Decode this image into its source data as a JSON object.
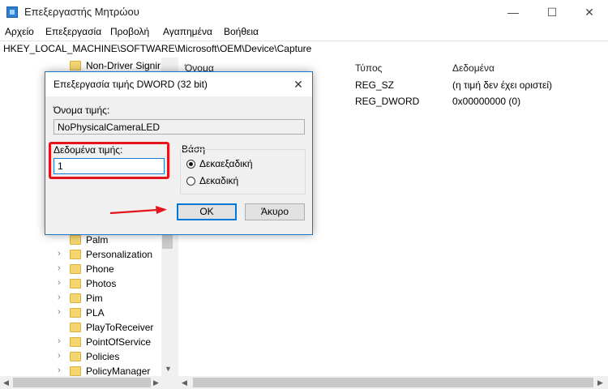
{
  "window": {
    "title": "Επεξεργαστής Μητρώου",
    "minimize_glyph": "—",
    "maximize_glyph": "☐",
    "close_glyph": "✕"
  },
  "menu": [
    "Αρχείο",
    "Επεξεργασία",
    "Προβολή",
    "Αγαπημένα",
    "Βοήθεια"
  ],
  "address": "HKEY_LOCAL_MACHINE\\SOFTWARE\\Microsoft\\OEM\\Device\\Capture",
  "tree": {
    "top_item": "Non-Driver Signir",
    "items": [
      "Palm",
      "Personalization",
      "Phone",
      "Photos",
      "Pim",
      "PLA",
      "PlayToReceiver",
      "PointOfService",
      "Policies",
      "PolicyManager"
    ]
  },
  "list": {
    "columns": [
      "Όνομα",
      "Τύπος",
      "Δεδομένα"
    ],
    "rows": [
      {
        "type": "REG_SZ",
        "data": "(η τιμή δεν έχει οριστεί)"
      },
      {
        "type": "REG_DWORD",
        "data": "0x00000000 (0)"
      }
    ]
  },
  "dialog": {
    "title": "Επεξεργασία τιμής DWORD (32 bit)",
    "close_glyph": "✕",
    "name_label": "Όνομα τιμής:",
    "name_value": "NoPhysicalCameraLED",
    "data_label": "Δεδομένα τιμής:",
    "data_value": "1",
    "base_label": "Βάση",
    "base_options": [
      {
        "label": "Δεκαεξαδική",
        "checked": true
      },
      {
        "label": "Δεκαδική",
        "checked": false
      }
    ],
    "ok_label": "OK",
    "cancel_label": "Άκυρο"
  },
  "colors": {
    "accent": "#0078d7",
    "highlight": "#e3141c",
    "folder": "#f5d572"
  }
}
